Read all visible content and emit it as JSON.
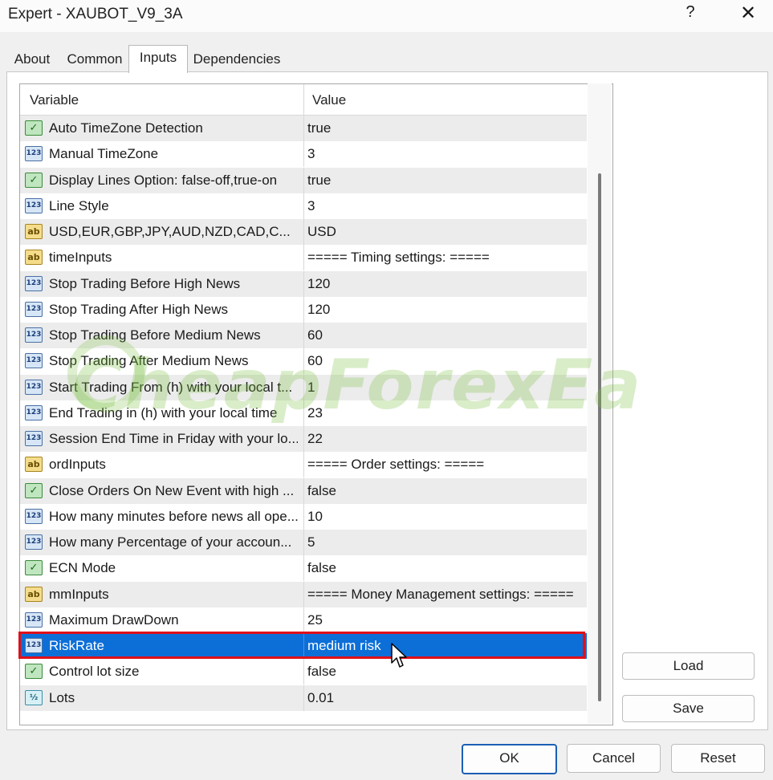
{
  "window": {
    "title": "Expert - XAUBOT_V9_3A",
    "help_glyph": "?",
    "close_glyph": "✕"
  },
  "tabs": [
    {
      "label": "About",
      "active": false
    },
    {
      "label": "Common",
      "active": false
    },
    {
      "label": "Inputs",
      "active": true
    },
    {
      "label": "Dependencies",
      "active": false
    }
  ],
  "grid": {
    "columns": {
      "variable": "Variable",
      "value": "Value"
    },
    "rows": [
      {
        "type": "bool",
        "icon_text": "✓",
        "name": "Auto TimeZone Detection",
        "value": "true"
      },
      {
        "type": "num",
        "icon_text": "123",
        "name": "Manual TimeZone",
        "value": "3"
      },
      {
        "type": "bool",
        "icon_text": "✓",
        "name": "Display Lines Option: false-off,true-on",
        "value": "true"
      },
      {
        "type": "num",
        "icon_text": "123",
        "name": "Line Style",
        "value": "3"
      },
      {
        "type": "str",
        "icon_text": "ab",
        "name": "USD,EUR,GBP,JPY,AUD,NZD,CAD,C...",
        "value": "USD"
      },
      {
        "type": "str",
        "icon_text": "ab",
        "name": "timeInputs",
        "value": "===== Timing settings: ====="
      },
      {
        "type": "num",
        "icon_text": "123",
        "name": "Stop Trading Before High News",
        "value": "120"
      },
      {
        "type": "num",
        "icon_text": "123",
        "name": "Stop Trading After High News",
        "value": "120"
      },
      {
        "type": "num",
        "icon_text": "123",
        "name": "Stop Trading Before Medium News",
        "value": "60"
      },
      {
        "type": "num",
        "icon_text": "123",
        "name": "Stop Trading After Medium News",
        "value": "60"
      },
      {
        "type": "num",
        "icon_text": "123",
        "name": "Start Trading From (h) with your local t...",
        "value": "1"
      },
      {
        "type": "num",
        "icon_text": "123",
        "name": "End Trading in (h) with your local time",
        "value": "23"
      },
      {
        "type": "num",
        "icon_text": "123",
        "name": "Session End Time in Friday with your lo...",
        "value": "22"
      },
      {
        "type": "str",
        "icon_text": "ab",
        "name": "ordInputs",
        "value": "===== Order settings: ====="
      },
      {
        "type": "bool",
        "icon_text": "✓",
        "name": "Close Orders On New Event with high ...",
        "value": "false"
      },
      {
        "type": "num",
        "icon_text": "123",
        "name": "How many minutes before news all ope...",
        "value": "10"
      },
      {
        "type": "num",
        "icon_text": "123",
        "name": "How many Percentage of your accoun...",
        "value": "5"
      },
      {
        "type": "bool",
        "icon_text": "✓",
        "name": "ECN Mode",
        "value": "false"
      },
      {
        "type": "str",
        "icon_text": "ab",
        "name": "mmInputs",
        "value": "===== Money Management settings: ====="
      },
      {
        "type": "num",
        "icon_text": "123",
        "name": "Maximum DrawDown",
        "value": "25"
      },
      {
        "type": "num",
        "icon_text": "123",
        "name": "RiskRate",
        "value": "medium risk",
        "selected": true
      },
      {
        "type": "bool",
        "icon_text": "✓",
        "name": "Control lot size",
        "value": "false"
      },
      {
        "type": "dbl",
        "icon_text": "½",
        "name": "Lots",
        "value": "0.01"
      }
    ]
  },
  "buttons": {
    "load": "Load",
    "save": "Save",
    "ok": "OK",
    "cancel": "Cancel",
    "reset": "Reset"
  },
  "watermark": {
    "text": "CheapForexEa"
  }
}
